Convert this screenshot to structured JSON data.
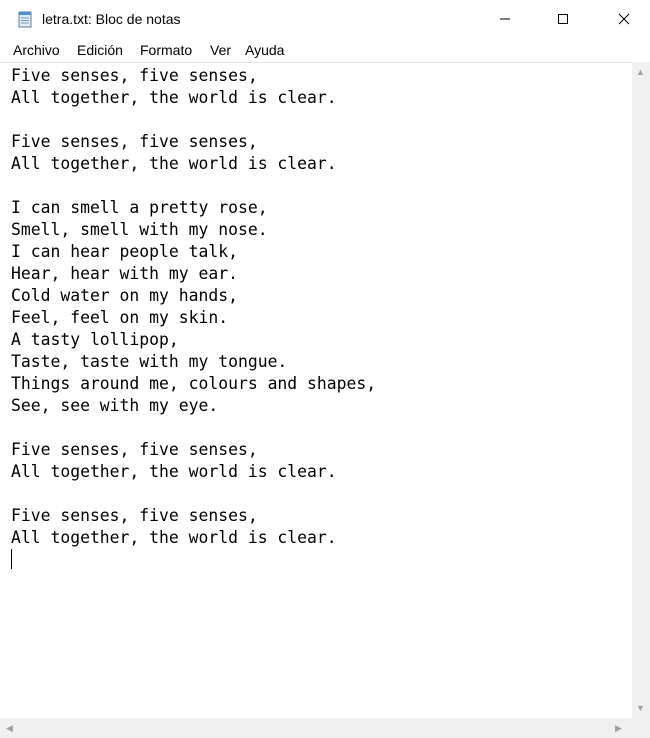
{
  "window": {
    "title": "letra.txt: Bloc de notas"
  },
  "menu": [
    "Archivo",
    "Edición",
    "Formato",
    "Ver",
    "Ayuda"
  ],
  "editor": {
    "content": "Five senses, five senses,\nAll together, the world is clear.\n\nFive senses, five senses,\nAll together, the world is clear.\n\nI can smell a pretty rose,\nSmell, smell with my nose.\nI can hear people talk,\nHear, hear with my ear.\nCold water on my hands,\nFeel, feel on my skin.\nA tasty lollipop,\nTaste, taste with my tongue.\nThings around me, colours and shapes,\nSee, see with my eye.\n\nFive senses, five senses,\nAll together, the world is clear.\n\nFive senses, five senses,\nAll together, the world is clear.\n"
  },
  "icons": {
    "app": "notepad-icon",
    "minimize": "minimize-icon",
    "maximize": "maximize-icon",
    "close": "close-icon"
  }
}
